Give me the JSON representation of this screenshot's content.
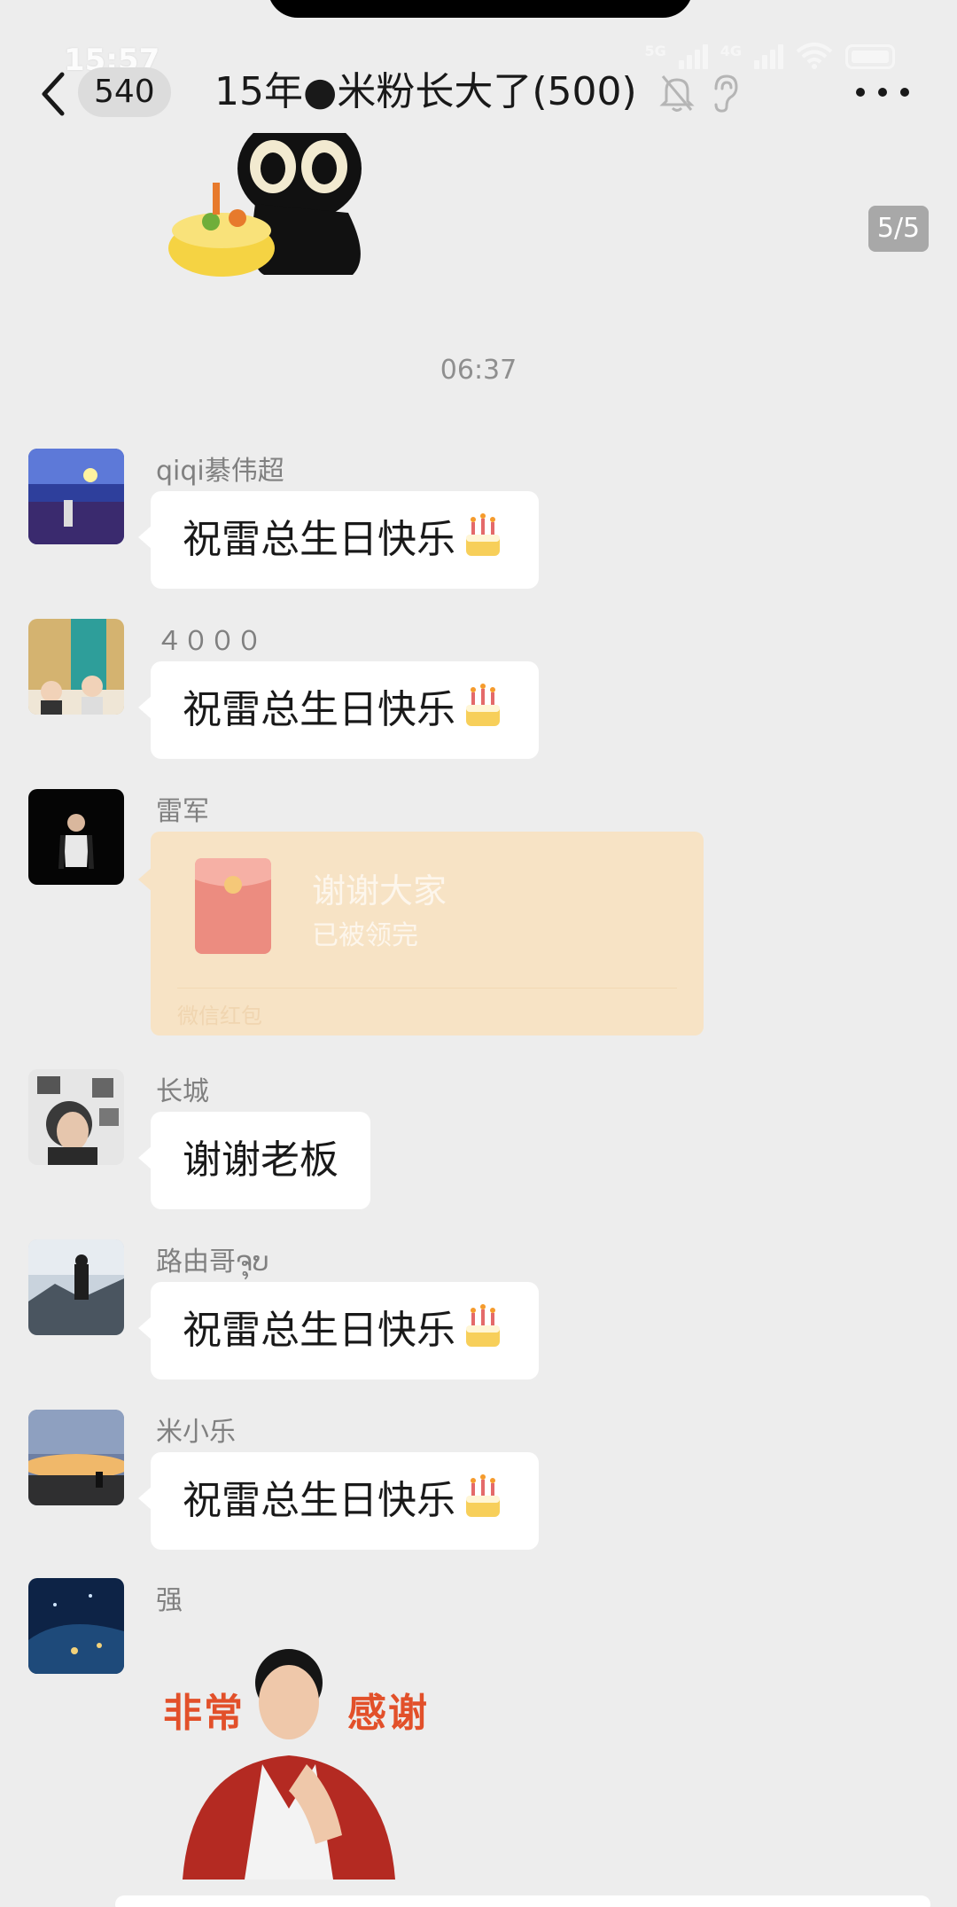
{
  "status_bar": {
    "time": "15:57",
    "network_1": "5G",
    "network_2": "4G"
  },
  "header": {
    "unread_count": "540",
    "title": "15年●米粉长大了(500)",
    "icons": [
      "back-arrow-icon",
      "mute-bell-icon",
      "ear-icon",
      "more-icon"
    ]
  },
  "page_indicator": "5/5",
  "timestamp": "06:37",
  "messages": [
    {
      "sender": "qiqi綦伟超",
      "text": "祝雷总生日快乐",
      "emoji": "birthday-cake-icon"
    },
    {
      "sender": "４０００",
      "text": "祝雷总生日快乐",
      "emoji": "birthday-cake-icon"
    },
    {
      "sender": "雷军",
      "red_packet": {
        "title": "谢谢大家",
        "status": "已被领完",
        "label": "微信红包"
      }
    },
    {
      "sender": "长城",
      "text": "谢谢老板"
    },
    {
      "sender": "路由哥ຈຸບ",
      "text": "祝雷总生日快乐",
      "emoji": "birthday-cake-icon"
    },
    {
      "sender": "米小乐",
      "text": "祝雷总生日快乐",
      "emoji": "birthday-cake-icon"
    },
    {
      "sender": "强",
      "sticker": {
        "text_left": "非常",
        "text_right": "感谢"
      }
    }
  ],
  "colors": {
    "background": "#ededed",
    "bubble": "#ffffff",
    "red_packet": "#f7e3c5",
    "sticker_text": "#e2502a"
  }
}
